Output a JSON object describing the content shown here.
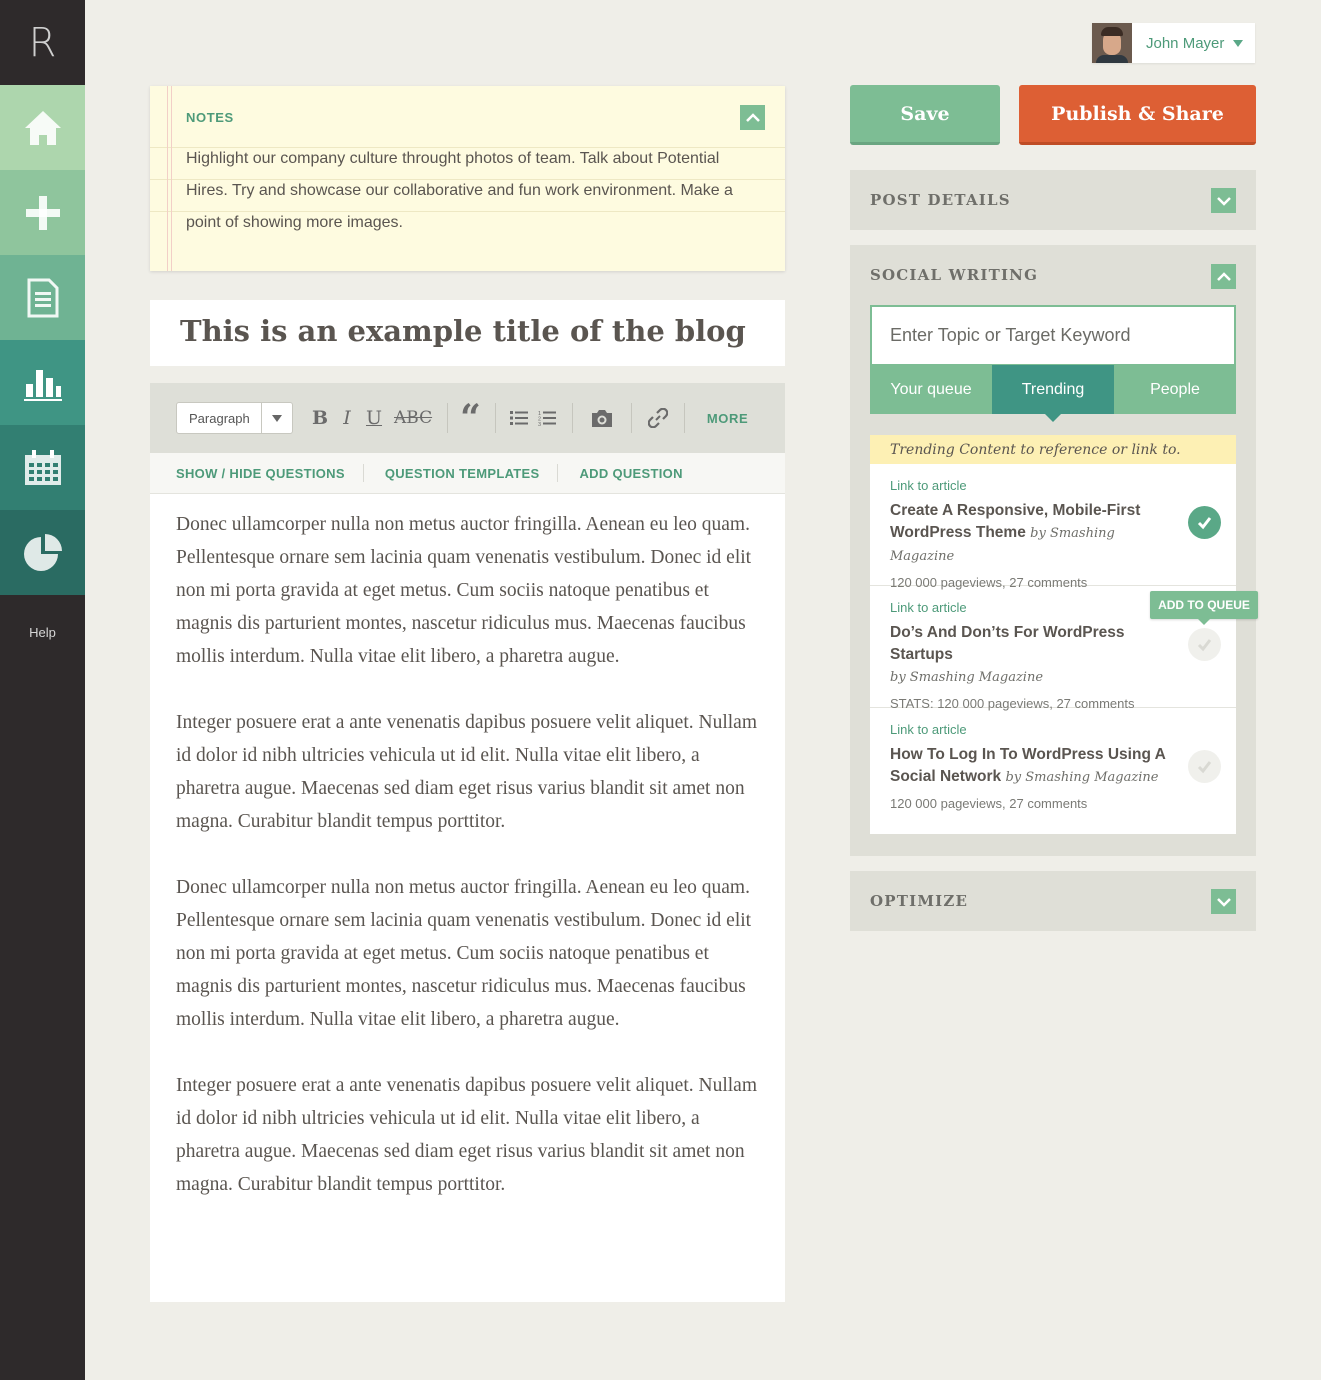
{
  "app": {
    "logo": "R",
    "help_label": "Help"
  },
  "nav": [
    {
      "id": "home",
      "icon": "home-icon"
    },
    {
      "id": "add",
      "icon": "plus-icon"
    },
    {
      "id": "docs",
      "icon": "document-icon"
    },
    {
      "id": "stats",
      "icon": "bar-chart-icon"
    },
    {
      "id": "calendar",
      "icon": "calendar-icon"
    },
    {
      "id": "pie",
      "icon": "pie-chart-icon"
    }
  ],
  "user": {
    "name": "John Mayer"
  },
  "notes": {
    "title": "NOTES",
    "body": "Highlight our company culture throught photos of team. Talk about Potential Hires. Try and showcase our collaborative and fun work environment. Make a point of showing more images."
  },
  "post": {
    "title": "This is an example title of the blog"
  },
  "toolbar": {
    "format": "Paragraph",
    "bold": "B",
    "italic": "I",
    "underline": "U",
    "strike": "ABC",
    "quote": "“",
    "more": "MORE"
  },
  "questions": {
    "show_hide": "SHOW / HIDE QUESTIONS",
    "templates": "QUESTION TEMPLATES",
    "add": "ADD QUESTION"
  },
  "body": {
    "paragraphs": [
      "Donec ullamcorper nulla non metus auctor fringilla. Aenean eu leo quam. Pellentesque ornare sem lacinia quam venenatis vestibulum. Donec id elit non mi porta gravida at eget metus. Cum sociis natoque penatibus et magnis dis parturient montes, nascetur ridiculus mus. Maecenas faucibus mollis interdum. Nulla vitae elit libero, a pharetra augue.",
      "Integer posuere erat a ante venenatis dapibus posuere velit aliquet. Nullam id dolor id nibh ultricies vehicula ut id elit. Nulla vitae elit libero, a pharetra augue. Maecenas sed diam eget risus varius blandit sit amet non magna. Curabitur blandit tempus porttitor.",
      "Donec ullamcorper nulla non metus auctor fringilla. Aenean eu leo quam. Pellentesque ornare sem lacinia quam venenatis vestibulum. Donec id elit non mi porta gravida at eget metus. Cum sociis natoque penatibus et magnis dis parturient montes, nascetur ridiculus mus. Maecenas faucibus mollis interdum. Nulla vitae elit libero, a pharetra augue.",
      "Integer posuere erat a ante venenatis dapibus posuere velit aliquet. Nullam id dolor id nibh ultricies vehicula ut id elit. Nulla vitae elit libero, a pharetra augue. Maecenas sed diam eget risus varius blandit sit amet non magna. Curabitur blandit tempus porttitor."
    ]
  },
  "actions": {
    "save": "Save",
    "publish": "Publish & Share"
  },
  "panels": {
    "post_details": "POST DETAILS",
    "social_writing": "SOCIAL WRITING",
    "optimize": "OPTIMIZE"
  },
  "social": {
    "placeholder": "Enter Topic or Target Keyword",
    "tabs": [
      "Your queue",
      "Trending",
      "People"
    ],
    "active_tab": "Trending",
    "note": "Trending Content to reference or link to.",
    "tooltip": "ADD TO QUEUE",
    "articles": [
      {
        "link": "Link to article",
        "title": "Create A Responsive, Mobile-First WordPress Theme",
        "by": "by Smashing Magazine",
        "stats": "120 000 pageviews, 27 comments",
        "queued": true
      },
      {
        "link": "Link to article",
        "title": "Do’s And Don’ts For WordPress Startups",
        "by": "by Smashing Magazine",
        "stats": "STATS: 120 000 pageviews, 27 comments",
        "queued": false
      },
      {
        "link": "Link to article",
        "title": "How To Log In To WordPress Using A Social Network",
        "by": "by Smashing Magazine",
        "stats": "120 000 pageviews, 27 comments",
        "queued": false
      }
    ]
  },
  "colors": {
    "accent_green": "#7dbd94",
    "dark_teal": "#3f9584",
    "publish_orange": "#dd5f34",
    "sidebar_dark": "#2e2a2b"
  }
}
